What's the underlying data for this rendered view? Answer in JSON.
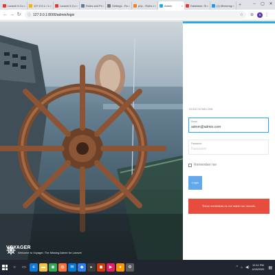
{
  "browser": {
    "tabs": [
      {
        "label": "Laravel 8 Com",
        "favicon_color": "#e53935",
        "active": false
      },
      {
        "label": "127.0.0.1 / 127",
        "favicon_color": "#f4b400",
        "active": false
      },
      {
        "label": "Laravel 8 Com",
        "favicon_color": "#e53935",
        "active": false
      },
      {
        "label": "Roles and Perm",
        "favicon_color": "#607d8b",
        "active": false
      },
      {
        "label": "Settings - Rou",
        "favicon_color": "#757575",
        "active": false
      },
      {
        "label": "php - Roles a",
        "favicon_color": "#f48024",
        "active": false
      },
      {
        "label": "Admin",
        "favicon_color": "#22a7f0",
        "active": true
      },
      {
        "label": "Database: See",
        "favicon_color": "#e53935",
        "active": false
      },
      {
        "label": "(1) Messenger",
        "favicon_color": "#2196f3",
        "active": false
      }
    ],
    "tab_close": "×",
    "new_tab": "+",
    "window_controls": {
      "minimize": "–",
      "maximize": "▢",
      "close": "✕"
    },
    "nav": {
      "back": "←",
      "forward": "→",
      "reload": "↻"
    },
    "address": {
      "info_icon": "ⓘ",
      "url": "127.0.0.1:8000/admin/login",
      "star": "☆"
    },
    "toolbar_icons": {
      "extension": "⊕",
      "menu_icon": "⋮",
      "profile_initial": "B"
    }
  },
  "hero": {
    "brand_name": "VOYAGER",
    "tagline": "Welcome to Voyager. The Missing Admin for Laravel"
  },
  "login": {
    "title": "SIGN IN BELOW:",
    "email": {
      "label": "Email",
      "value": "admin@admin.com"
    },
    "password": {
      "label": "Password",
      "placeholder": "Password",
      "value": ""
    },
    "remember_label": "Remember me",
    "remember_checked": false,
    "button_label": "Login",
    "error_message": "These credentials do not match our records.",
    "colors": {
      "accent": "#22a7f0",
      "button": "#62a8ea",
      "error": "#e74c3c"
    }
  },
  "taskbar": {
    "apps": [
      {
        "icon": "search-icon",
        "glyph": "○",
        "color": "#202530"
      },
      {
        "icon": "task-view-icon",
        "glyph": "▭",
        "color": "#202530"
      },
      {
        "icon": "edge-icon",
        "glyph": "e",
        "color": "#0f7bd8"
      },
      {
        "icon": "file-explorer-icon",
        "glyph": "▬",
        "color": "#f4c542"
      },
      {
        "icon": "chrome-icon",
        "glyph": "◉",
        "color": "#34a853"
      },
      {
        "icon": "firefox-icon",
        "glyph": "◍",
        "color": "#ff7139"
      },
      {
        "icon": "mail-icon",
        "glyph": "✉",
        "color": "#0078d4"
      },
      {
        "icon": "vscode-icon",
        "glyph": "◆",
        "color": "#2f80ed"
      },
      {
        "icon": "terminal-icon",
        "glyph": "▸",
        "color": "#3b3b3b"
      },
      {
        "icon": "store-icon",
        "glyph": "◼",
        "color": "#d83b01"
      },
      {
        "icon": "media-icon",
        "glyph": "▶",
        "color": "#e91e63"
      },
      {
        "icon": "app-icon",
        "glyph": "●",
        "color": "#ff9800"
      },
      {
        "icon": "settings-icon",
        "glyph": "⚙",
        "color": "#5c5c5c"
      }
    ],
    "tray_up": "^",
    "tray_network": "⌂",
    "tray_volume": "◀)",
    "time": "12:11 PM",
    "date": "4/19/2020",
    "notification": "▤"
  }
}
